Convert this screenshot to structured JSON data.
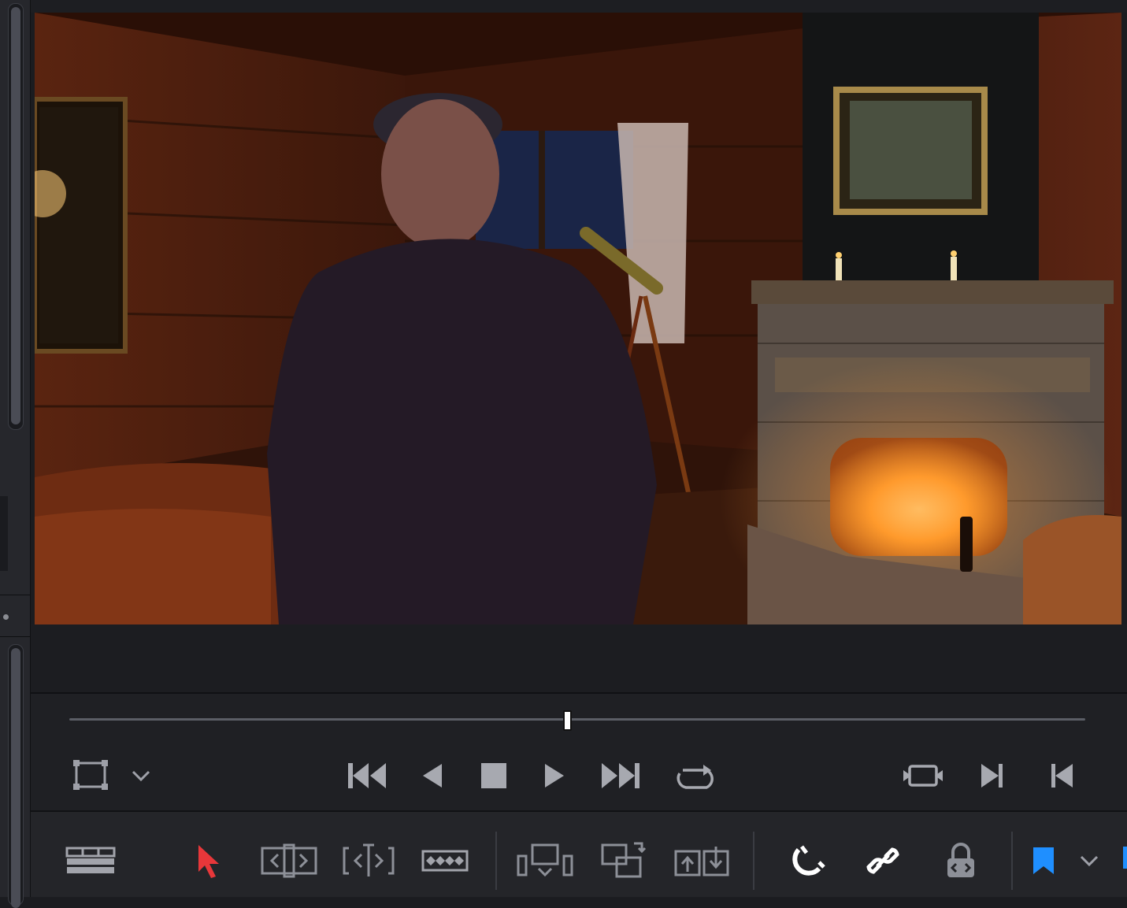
{
  "app": {
    "accent_color": "#1f8fff",
    "active_tool_color": "#e8373a"
  },
  "viewer": {
    "image_description_icon": "image-icon",
    "playhead_fraction": 0.49
  },
  "transport": {
    "buttons": [
      {
        "name": "viewer-mode-button",
        "icon": "frame-rectangle-icon"
      },
      {
        "name": "viewer-mode-dropdown",
        "icon": "chevron-down-icon"
      },
      {
        "name": "go-to-start-button",
        "icon": "skip-to-start-icon"
      },
      {
        "name": "play-reverse-button",
        "icon": "play-reverse-icon"
      },
      {
        "name": "stop-button",
        "icon": "stop-icon"
      },
      {
        "name": "play-button",
        "icon": "play-icon"
      },
      {
        "name": "go-to-end-button",
        "icon": "skip-to-end-icon"
      },
      {
        "name": "loop-button",
        "icon": "loop-icon"
      },
      {
        "name": "match-frame-button",
        "icon": "match-frame-icon"
      },
      {
        "name": "next-edit-button",
        "icon": "next-edit-icon"
      },
      {
        "name": "previous-edit-button",
        "icon": "previous-edit-icon"
      }
    ]
  },
  "toolbar": {
    "tools": [
      {
        "name": "timeline-view-options",
        "icon": "timeline-layout-icon"
      },
      {
        "name": "selection-mode-tool",
        "icon": "arrow-pointer-icon",
        "active": true
      },
      {
        "name": "trim-edit-mode-tool",
        "icon": "trim-edit-icon"
      },
      {
        "name": "dynamic-trim-mode-tool",
        "icon": "dynamic-trim-icon"
      },
      {
        "name": "blade-edit-mode-tool",
        "icon": "blade-icon"
      },
      {
        "name": "insert-clip-tool",
        "icon": "insert-clip-icon"
      },
      {
        "name": "overwrite-clip-tool",
        "icon": "overwrite-clip-icon"
      },
      {
        "name": "replace-clip-tool",
        "icon": "replace-clip-icon"
      },
      {
        "name": "snapping-toggle",
        "icon": "magnet-icon"
      },
      {
        "name": "linked-selection-toggle",
        "icon": "link-icon"
      },
      {
        "name": "position-lock-toggle",
        "icon": "lock-icon"
      },
      {
        "name": "flag-button",
        "icon": "flag-icon"
      },
      {
        "name": "flag-dropdown",
        "icon": "chevron-down-icon"
      }
    ]
  }
}
